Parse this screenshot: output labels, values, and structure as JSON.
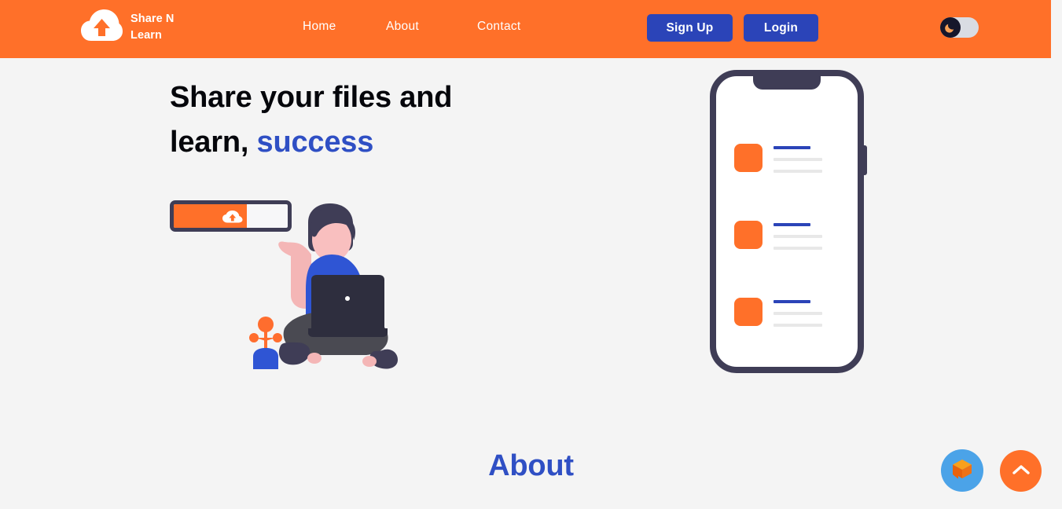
{
  "theme": {
    "orange": "#ff7029",
    "blue": "#2b44b8",
    "accent_blue": "#2f4fc4",
    "navy": "#3f3d56",
    "page_bg": "#f4f4f4"
  },
  "header": {
    "brand": {
      "name": "Share N Learn",
      "logo_icon": "cloud-upload-icon"
    },
    "nav": [
      {
        "label": "Home"
      },
      {
        "label": "About"
      },
      {
        "label": "Contact"
      }
    ],
    "auth": {
      "signup_label": "Sign Up",
      "login_label": "Login"
    },
    "theme_toggle": {
      "icon": "moon-icon",
      "state": "light"
    }
  },
  "hero": {
    "heading_line1": "Share your files and",
    "heading_line2_prefix": "learn, ",
    "heading_line2_accent": "success",
    "upload_widget": {
      "icon": "cloud-upload-icon",
      "progress": 64
    },
    "illustration": "person-sitting-with-laptop"
  },
  "phone": {
    "list": [
      {
        "thumb": "orange-thumbnail",
        "title_bar": true,
        "text_lines": 2
      },
      {
        "thumb": "orange-thumbnail",
        "title_bar": true,
        "text_lines": 2
      },
      {
        "thumb": "orange-thumbnail",
        "title_bar": true,
        "text_lines": 2
      }
    ]
  },
  "about": {
    "title": "About"
  },
  "floating": {
    "chat_icon": "box-chat-icon",
    "scroll_top_icon": "chevron-up-icon"
  }
}
